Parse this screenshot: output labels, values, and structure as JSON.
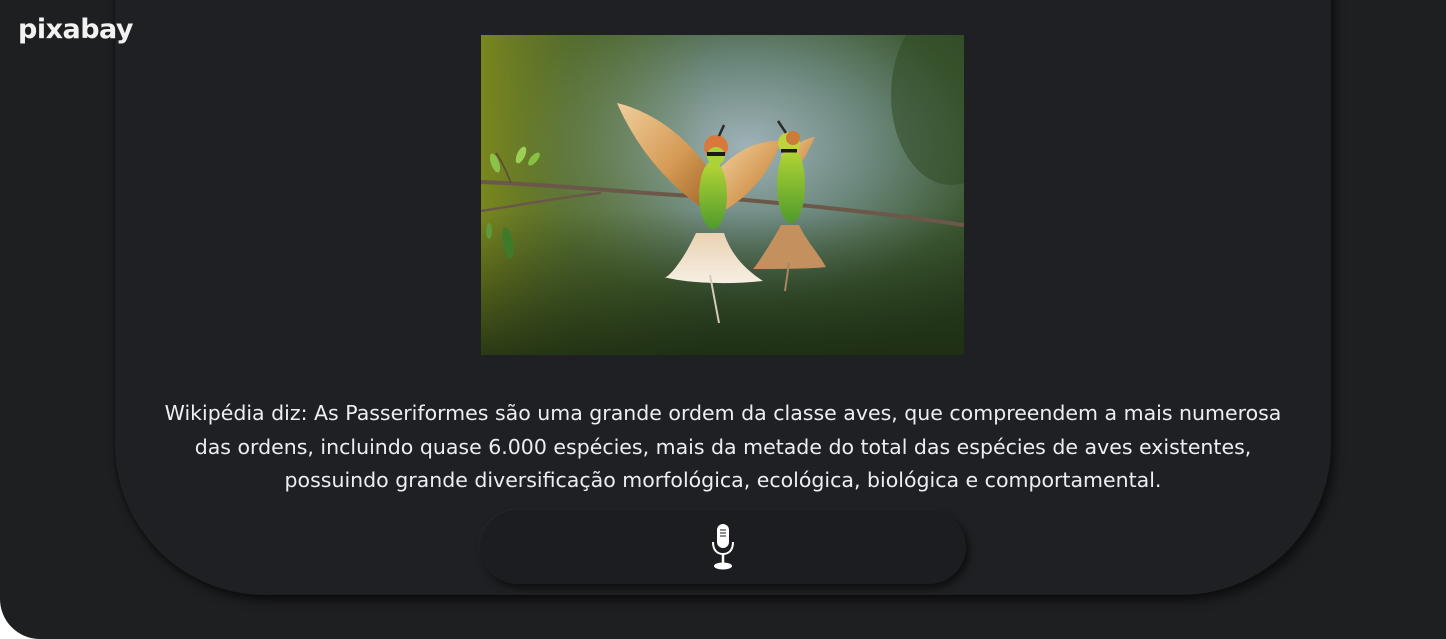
{
  "brand": {
    "logo_text": "pixabay"
  },
  "photo": {
    "alt": "Two bee-eater birds on a branch",
    "icon": "bird-photo"
  },
  "caption": {
    "text": "Wikipédia diz: As Passeriformes são uma grande ordem da classe aves, que compreendem a mais numerosa das ordens, incluindo quase 6.000 espécies, mais da metade do total das espécies de aves existentes, possuindo grande diversificação morfológica, ecológica, biológica e comportamental."
  },
  "voice": {
    "icon": "microphone-icon"
  },
  "colors": {
    "background": "#1e1f21",
    "card": "#1f2023",
    "text": "#eceff1",
    "button": "#1c1d20"
  }
}
